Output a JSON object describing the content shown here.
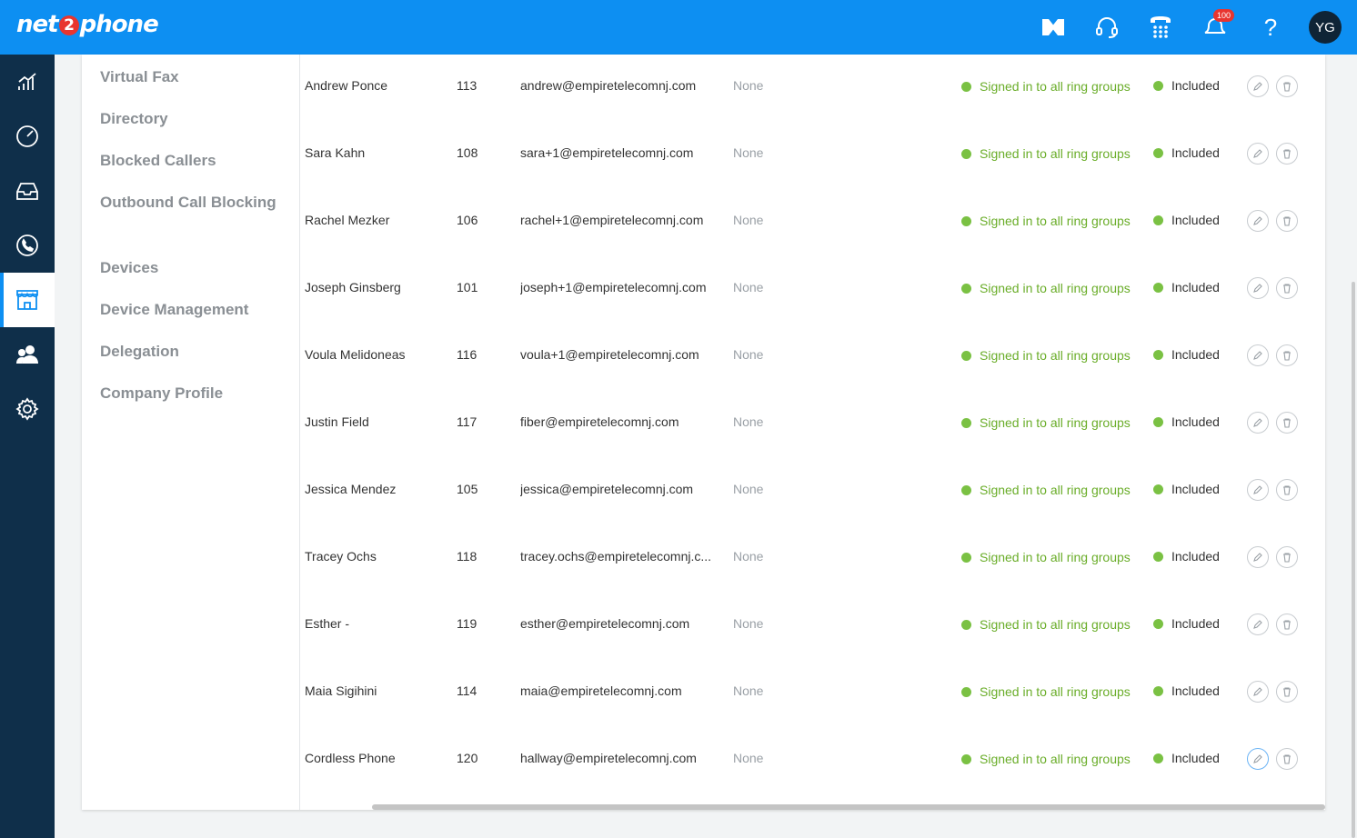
{
  "brand": {
    "logo_pre": "net",
    "logo_mid": "2",
    "logo_post": "phone",
    "primary_color": "#0d8ff2",
    "rail_color": "#0f2f4a"
  },
  "header": {
    "icons": [
      "meeting-icon",
      "support-headset-icon",
      "phone-keypad-icon",
      "notifications-icon",
      "help-icon"
    ],
    "notification_count": "100",
    "help_label": "?",
    "user_initials": "YG"
  },
  "rail": {
    "items": [
      "analytics-icon",
      "dashboard-gauge-icon",
      "inbox-icon",
      "phone-icon",
      "store-icon",
      "users-icon",
      "settings-gear-icon"
    ],
    "active_index": 4
  },
  "subnav": {
    "items": [
      "Virtual Fax",
      "Directory",
      "Blocked Callers",
      "Outbound Call Blocking",
      "Devices",
      "Device Management",
      "Delegation",
      "Company Profile"
    ]
  },
  "users": [
    {
      "name": "Andrew Ponce",
      "ext": "113",
      "email": "andrew@empiretelecomnj.com",
      "device": "None",
      "status": "Signed in to all ring groups",
      "plan": "Included"
    },
    {
      "name": "Sara Kahn",
      "ext": "108",
      "email": "sara+1@empiretelecomnj.com",
      "device": "None",
      "status": "Signed in to all ring groups",
      "plan": "Included"
    },
    {
      "name": "Rachel Mezker",
      "ext": "106",
      "email": "rachel+1@empiretelecomnj.com",
      "device": "None",
      "status": "Signed in to all ring groups",
      "plan": "Included"
    },
    {
      "name": "Joseph Ginsberg",
      "ext": "101",
      "email": "joseph+1@empiretelecomnj.com",
      "device": "None",
      "status": "Signed in to all ring groups",
      "plan": "Included"
    },
    {
      "name": "Voula Melidoneas",
      "ext": "116",
      "email": "voula+1@empiretelecomnj.com",
      "device": "None",
      "status": "Signed in to all ring groups",
      "plan": "Included"
    },
    {
      "name": "Justin Field",
      "ext": "117",
      "email": "fiber@empiretelecomnj.com",
      "device": "None",
      "status": "Signed in to all ring groups",
      "plan": "Included"
    },
    {
      "name": "Jessica Mendez",
      "ext": "105",
      "email": "jessica@empiretelecomnj.com",
      "device": "None",
      "status": "Signed in to all ring groups",
      "plan": "Included"
    },
    {
      "name": "Tracey Ochs",
      "ext": "118",
      "email": "tracey.ochs@empiretelecomnj.c...",
      "device": "None",
      "status": "Signed in to all ring groups",
      "plan": "Included"
    },
    {
      "name": "Esther -",
      "ext": "119",
      "email": "esther@empiretelecomnj.com",
      "device": "None",
      "status": "Signed in to all ring groups",
      "plan": "Included"
    },
    {
      "name": "Maia Sigihini",
      "ext": "114",
      "email": "maia@empiretelecomnj.com",
      "device": "None",
      "status": "Signed in to all ring groups",
      "plan": "Included"
    },
    {
      "name": "Cordless Phone",
      "ext": "120",
      "email": "hallway@empiretelecomnj.com",
      "device": "None",
      "status": "Signed in to all ring groups",
      "plan": "Included"
    }
  ],
  "status_color": "#6aad29"
}
